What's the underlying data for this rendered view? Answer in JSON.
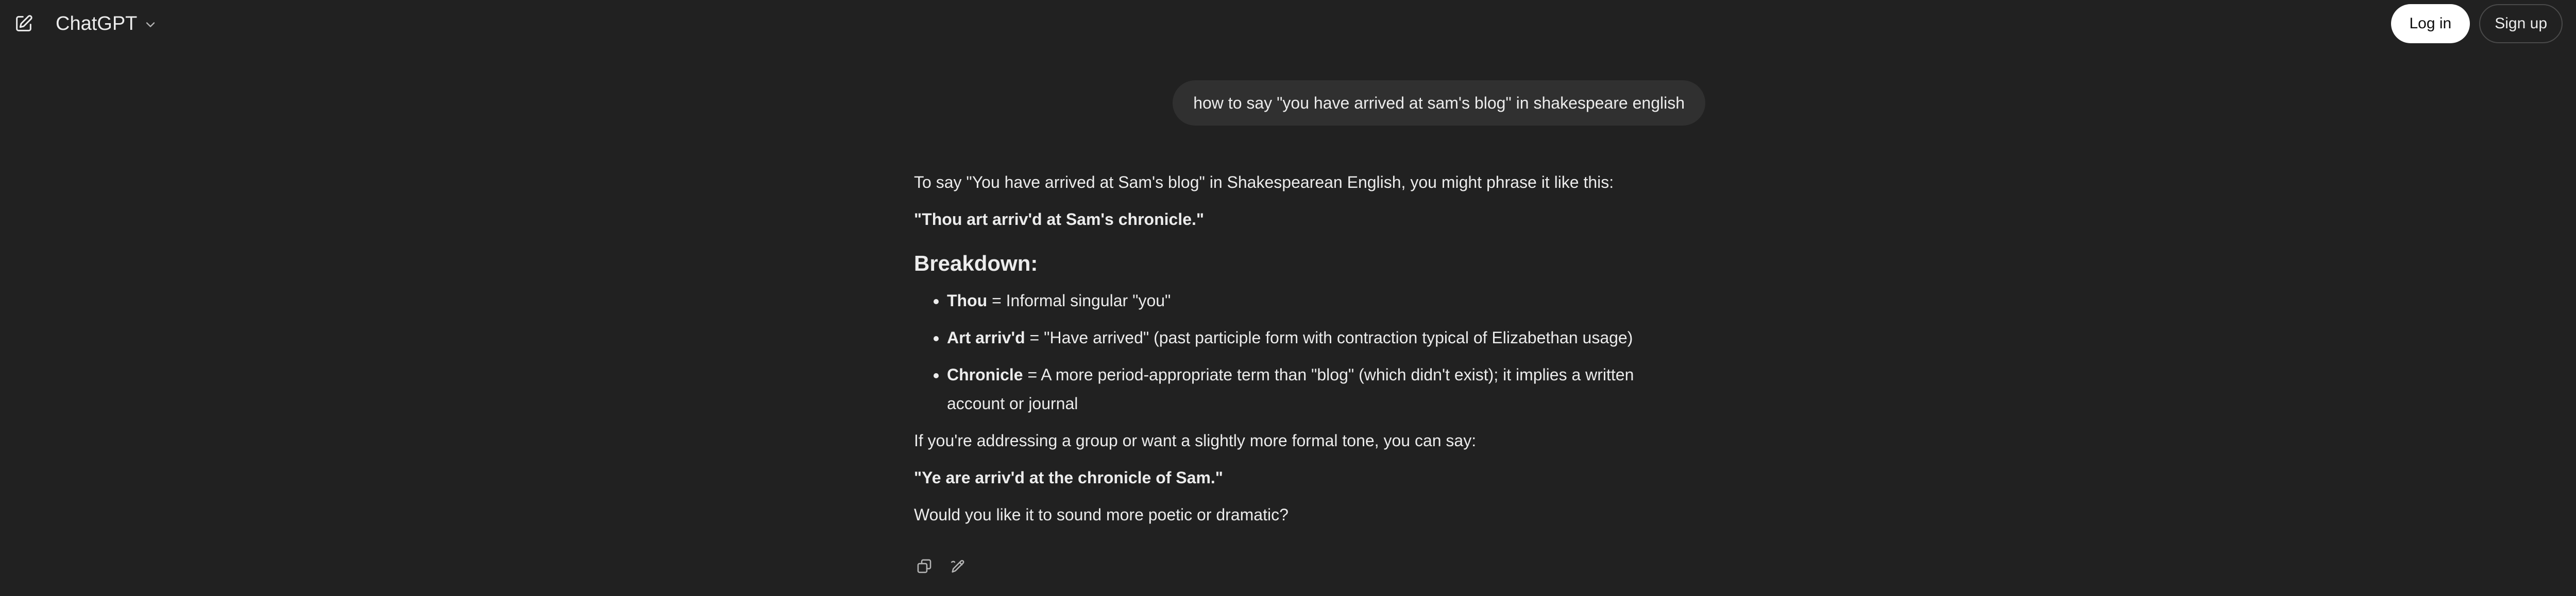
{
  "header": {
    "model_name": "ChatGPT",
    "login_label": "Log in",
    "signup_label": "Sign up",
    "icons": {
      "new_chat": "new-chat-icon",
      "model_dropdown": "chevron-down-icon",
      "help": "help-icon"
    }
  },
  "conversation": {
    "user_message": "how to say \"you have arrived at sam's blog\" in shakespeare english",
    "assistant": {
      "intro": "To say \"You have arrived at Sam's blog\" in Shakespearean English, you might phrase it like this:",
      "quote1": "\"Thou art arriv'd at Sam's chronicle.\"",
      "breakdown_heading": "Breakdown:",
      "breakdown": [
        {
          "term": "Thou",
          "definition": " = Informal singular \"you\""
        },
        {
          "term": "Art arriv'd",
          "definition": " = \"Have arrived\" (past participle form with contraction typical of Elizabethan usage)"
        },
        {
          "term": "Chronicle",
          "definition": " = A more period-appropriate term than \"blog\" (which didn't exist); it implies a written account or journal"
        }
      ],
      "formal_intro": "If you're addressing a group or want a slightly more formal tone, you can say:",
      "quote2": "\"Ye are arriv'd at the chronicle of Sam.\"",
      "closing": "Would you like it to sound more poetic or dramatic?"
    },
    "actions": {
      "copy": "copy-icon",
      "edit": "edit-icon"
    }
  },
  "colors": {
    "background": "#212121",
    "user_bubble": "#303030",
    "text": "#ececec",
    "login_bg": "#ffffff"
  }
}
